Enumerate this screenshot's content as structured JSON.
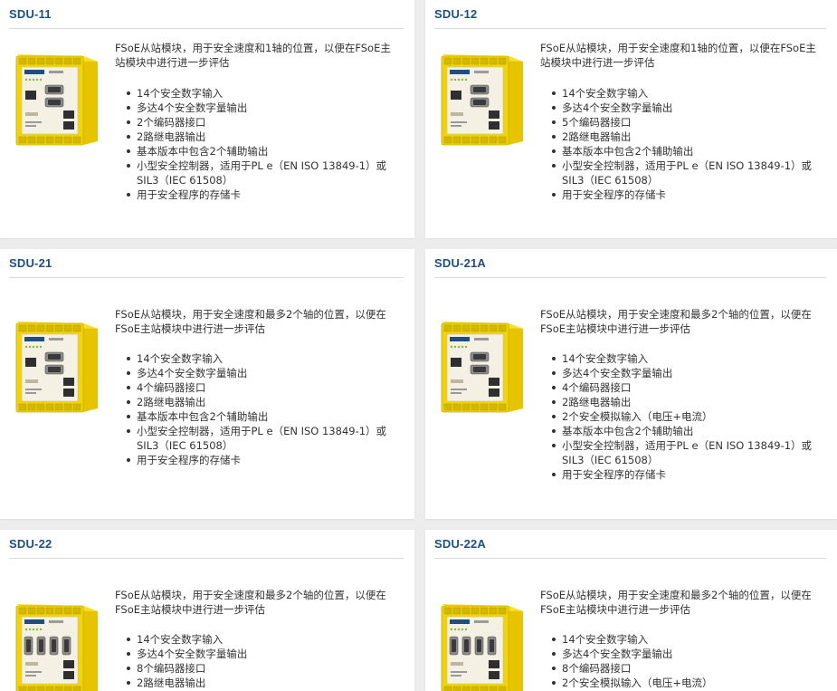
{
  "products": [
    {
      "title": "SDU-11",
      "description": "FSoE从站模块，用于安全速度和1轴的位置，以便在FSoE主站模块中进行进一步评估",
      "features": [
        "14个安全数字输入",
        "多达4个安全数字量输出",
        "2个编码器接口",
        "2路继电器输出",
        "基本版本中包含2个辅助输出",
        "小型安全控制器，适用于PL e（EN ISO 13849-1）或SIL3（IEC 61508）",
        "用于安全程序的存储卡"
      ],
      "image": "SDU-11 yellow safety module photo",
      "image_label": "SDU-11"
    },
    {
      "title": "SDU-12",
      "description": "FSoE从站模块，用于安全速度和1轴的位置，以便在FSoE主站模块中进行进一步评估",
      "features": [
        "14个安全数字输入",
        "多达4个安全数字量输出",
        "5个编码器接口",
        "2路继电器输出",
        "基本版本中包含2个辅助输出",
        "小型安全控制器，适用于PL e（EN ISO 13849-1）或SIL3（IEC 61508）",
        "用于安全程序的存储卡"
      ],
      "image": "SDU-12 yellow safety module photo",
      "image_label": "SDU-12"
    },
    {
      "title": "SDU-21",
      "description": "FSoE从站模块，用于安全速度和最多2个轴的位置，以便在FSoE主站模块中进行进一步评估",
      "features": [
        "14个安全数字输入",
        "多达4个安全数字量输出",
        "4个编码器接口",
        "2路继电器输出",
        "基本版本中包含2个辅助输出",
        "小型安全控制器，适用于PL e（EN ISO 13849-1）或SIL3（IEC 61508）",
        "用于安全程序的存储卡"
      ],
      "image": "SDU-21 yellow safety module photo",
      "image_label": "SDU-21"
    },
    {
      "title": "SDU-21A",
      "description": "FSoE从站模块，用于安全速度和最多2个轴的位置，以便在FSoE主站模块中进行进一步评估",
      "features": [
        "14个安全数字输入",
        "多达4个安全数字量输出",
        "4个编码器接口",
        "2路继电器输出",
        "2个安全模拟输入（电压+电流）",
        "基本版本中包含2个辅助输出",
        "小型安全控制器，适用于PL e（EN ISO 13849-1）或SIL3（IEC 61508）",
        "用于安全程序的存储卡"
      ],
      "image": "SDU-21A yellow safety module photo",
      "image_label": "SDU-21A"
    },
    {
      "title": "SDU-22",
      "description": "FSoE从站模块，用于安全速度和最多2个轴的位置，以便在FSoE主站模块中进行进一步评估",
      "features": [
        "14个安全数字输入",
        "多达4个安全数字量输出",
        "8个编码器接口",
        "2路继电器输出"
      ],
      "image": "SDU-22 yellow safety module photo",
      "image_label": "SDU-22"
    },
    {
      "title": "SDU-22A",
      "description": "FSoE从站模块，用于安全速度和最多2个轴的位置，以便在FSoE主站模块中进行进一步评估",
      "features": [
        "14个安全数字输入",
        "多达4个安全数字量输出",
        "8个编码器接口",
        "2个安全模拟输入（电压+电流）"
      ],
      "image": "SDU-22A yellow safety module photo",
      "image_label": "SDU-22A"
    }
  ],
  "colors": {
    "title": "#1d4f82",
    "module_yellow": "#f2d500",
    "page_background": "#ececec",
    "card_background": "#ffffff"
  }
}
